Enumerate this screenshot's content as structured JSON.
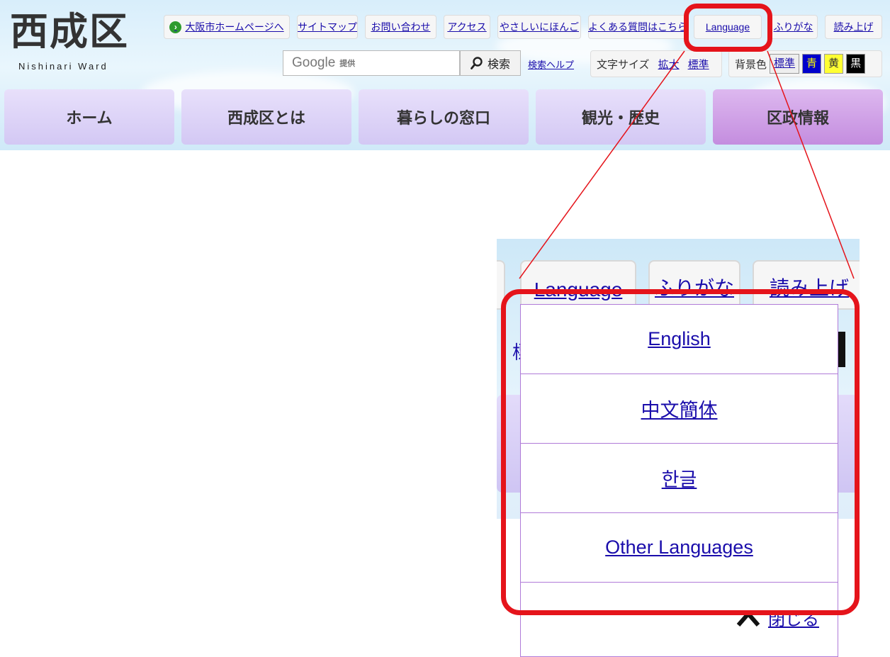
{
  "header": {
    "logo_title": "西成区",
    "logo_sub": "Nishinari Ward",
    "top_links": {
      "osaka_home": "大阪市ホームページへ",
      "sitemap": "サイトマップ",
      "contact": "お問い合わせ",
      "access": "アクセス",
      "easy_japanese": "やさしいにほんご",
      "faq": "よくある質問はこちら",
      "language": "Language",
      "furigana": "ふりがな",
      "read_aloud": "読み上げ"
    },
    "search": {
      "google_label": "Google",
      "provided": "提供",
      "button": "検索",
      "help": "検索ヘルプ"
    },
    "text_size": {
      "label": "文字サイズ",
      "enlarge": "拡大",
      "standard": "標準"
    },
    "bg_color": {
      "label": "背景色",
      "standard": "標準",
      "blue": "青",
      "yellow": "黄",
      "black": "黒"
    }
  },
  "nav": {
    "items": [
      "ホーム",
      "西成区とは",
      "暮らしの窓口",
      "観光・歴史",
      "区政情報"
    ]
  },
  "zoom": {
    "tabs": [
      "Language",
      "ふりがな",
      "読み上げ"
    ],
    "fragment": "標",
    "dropdown": [
      "English",
      "中文簡体",
      "한글",
      "Other Languages"
    ],
    "close": "閉じる"
  },
  "colors": {
    "highlight": "#e5141b",
    "nav_active": "#c48ddf",
    "nav_default": "#d3c8f4",
    "link": "#1a0dab"
  }
}
